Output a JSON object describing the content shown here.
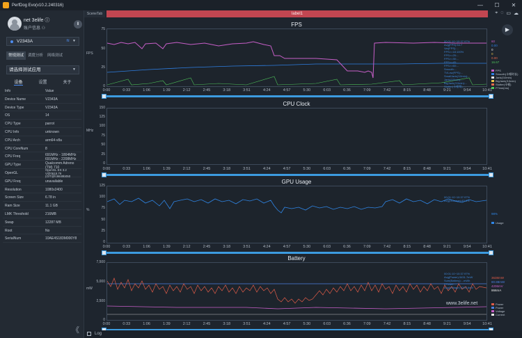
{
  "window": {
    "title": "PerfDog Evo(v10.2.240316)",
    "min": "—",
    "max": "☐",
    "close": "✕"
  },
  "user": {
    "name": "net 3elife ⓘ",
    "info": "账户信息 ⚇",
    "btn": "Ⅱ"
  },
  "device": {
    "name": "V2343A"
  },
  "modes": [
    "常规测试",
    "调度分析",
    "网络测试"
  ],
  "app_select": "请选择测试应用",
  "subtabs": [
    "设备",
    "设置",
    "关于"
  ],
  "device_info": {
    "header": {
      "k": "Info",
      "v": "Value"
    },
    "rows": [
      {
        "k": "Device Name",
        "v": "V2343A"
      },
      {
        "k": "Device Type",
        "v": "V2343A"
      },
      {
        "k": "OS",
        "v": "14"
      },
      {
        "k": "CPU Type",
        "v": "parrot"
      },
      {
        "k": "CPU Info",
        "v": "unknown"
      },
      {
        "k": "CPU Arch",
        "v": "arm64-v8a"
      },
      {
        "k": "CPU CoreNum",
        "v": "8"
      },
      {
        "k": "CPU Freq",
        "v": "691MHz - 1804MHz\n691MHz - 2208MHz"
      },
      {
        "k": "GPU Type",
        "v": "Qualcomm Adreno\n(TM) 710"
      },
      {
        "k": "OpenGL",
        "v": "OpenGL ES 3.2\nV@0615.76\n(GIT@fc9849b050"
      },
      {
        "k": "GPU Freq",
        "v": "unavailable"
      },
      {
        "k": "Resolution",
        "v": "1080x2400"
      },
      {
        "k": "Screen Size",
        "v": "6.78 in"
      },
      {
        "k": "Ram Size",
        "v": "11.1 GB"
      },
      {
        "k": "LMK Threshold",
        "v": "216MB"
      },
      {
        "k": "Swap",
        "v": "12287 MB"
      },
      {
        "k": "Root",
        "v": "No"
      },
      {
        "k": "SerialNum",
        "v": "10AE4S183M000Y8"
      }
    ]
  },
  "collapse": "《",
  "topbar": {
    "scene_tab": "SceneTab",
    "label": "label1"
  },
  "x_ticks": [
    "0:00",
    "0:33",
    "1:06",
    "1:39",
    "2:12",
    "2:45",
    "3:18",
    "3:51",
    "4:24",
    "4:57",
    "5:30",
    "6:03",
    "6:36",
    "7:09",
    "7:42",
    "8:15",
    "8:48",
    "9:21",
    "9:54",
    "10:41"
  ],
  "charts": {
    "fps": {
      "title": "FPS",
      "ylabel": "FPS",
      "yticks": [
        "75",
        "50",
        "25",
        "0"
      ],
      "legend": [
        "00:01:10~10:37.97%",
        "Avg(FPS):54.7",
        "Var(FPS):...",
        "FPS>=18:100%",
        "FPS>=25:...",
        "FPS>=30:...",
        "FPS>=45:...",
        "FPS>=60:...",
        "Smooth:...",
        "TVLow(FPS):...",
        "SmallJank(/10min):...",
        "Jank(/10min):...",
        "BigJank(/10min):...",
        "Stutter(卡顿率):..."
      ],
      "series": [
        {
          "name": "FPS",
          "color": "#c85fc9"
        },
        {
          "name": "Smooth(卡顿时长)",
          "color": "#2e7fe3"
        },
        {
          "name": "Jank(/10min)",
          "color": "#e8e8e8"
        },
        {
          "name": "BigJank(/10min)",
          "color": "#e8c04a"
        },
        {
          "name": "Stutter(卡顿)",
          "color": "#e66a4c"
        },
        {
          "name": "FTime(ms)",
          "color": "#4fc55b"
        }
      ],
      "right_values": [
        "60",
        "0.00",
        "0",
        "0",
        "0.00",
        "16.67"
      ]
    },
    "cpu": {
      "title": "CPU Clock",
      "ylabel": "MHz",
      "yticks": [
        "150",
        "125",
        "100",
        "75",
        "50",
        "25",
        "0"
      ]
    },
    "gpu": {
      "title": "GPU Usage",
      "ylabel": "%",
      "yticks": [
        "125",
        "100",
        "75",
        "50",
        "25",
        "0"
      ],
      "legend": [
        "00:01:10~10:37.97%",
        "Avg(GUsage):83.3%"
      ],
      "series": [
        {
          "name": "Usage",
          "color": "#2f86e6"
        }
      ],
      "right_values": [
        "98%"
      ]
    },
    "battery": {
      "title": "Battery",
      "ylabel": "mW",
      "yticks": [
        "7,500",
        "5,000",
        "2,500",
        "0"
      ],
      "legend": [
        "00:01:10~10:37.97%",
        "Avg(Power):3431.7mW",
        "Sum(Battery):...mWh",
        "FPower:...",
        "Avg(Voltage):4204.6mV"
      ],
      "series": [
        {
          "name": "Power",
          "color": "#e05c48"
        },
        {
          "name": "Power",
          "color": "#4a7fe0"
        },
        {
          "name": "Voltage",
          "color": "#c85fc9"
        },
        {
          "name": "Current",
          "color": "#e8e8e8"
        }
      ],
      "right_values": [
        "3638mW",
        "80.88mW",
        "4206mV",
        "866mA"
      ]
    }
  },
  "log": "Log",
  "watermark": "www.3elife.net"
}
